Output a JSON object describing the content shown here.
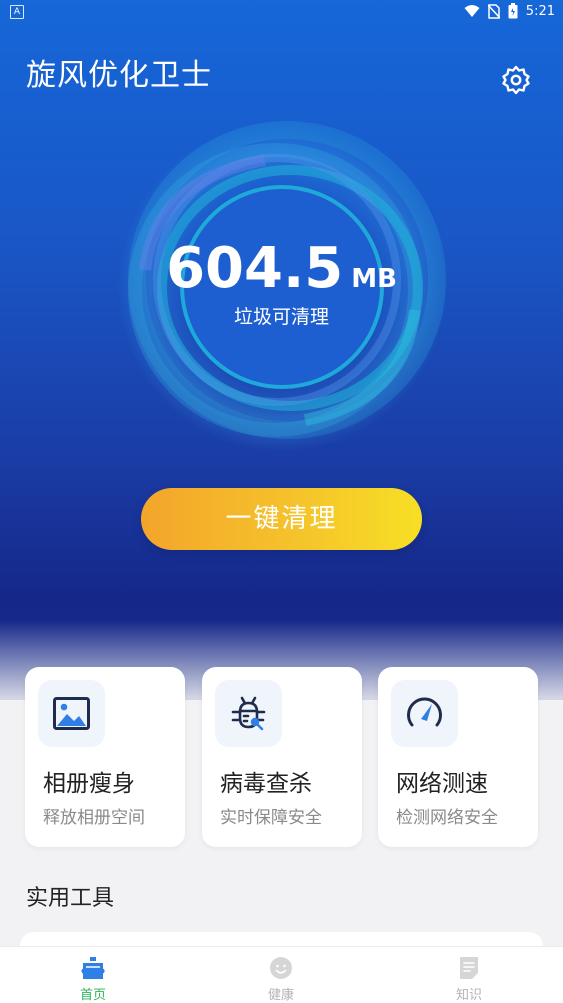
{
  "status": {
    "time": "5:21",
    "left_icon": "A"
  },
  "header": {
    "title": "旋风优化卫士"
  },
  "summary": {
    "amount": "604.5",
    "unit": "MB",
    "label": "垃圾可清理"
  },
  "action": {
    "clean_label": "一键清理"
  },
  "features": [
    {
      "title": "相册瘦身",
      "desc": "释放相册空间",
      "icon": "photo-icon"
    },
    {
      "title": "病毒查杀",
      "desc": "实时保障安全",
      "icon": "bug-icon"
    },
    {
      "title": "网络测速",
      "desc": "检测网络安全",
      "icon": "speedometer-icon"
    }
  ],
  "tools": {
    "title": "实用工具"
  },
  "tabs": [
    {
      "label": "首页",
      "icon": "home-icon",
      "active": true
    },
    {
      "label": "健康",
      "icon": "smiley-icon",
      "active": false
    },
    {
      "label": "知识",
      "icon": "document-icon",
      "active": false
    }
  ],
  "colors": {
    "accent_green": "#2fb35a",
    "button_yellow": "#f5c32b",
    "hero_blue": "#1a56c6"
  }
}
